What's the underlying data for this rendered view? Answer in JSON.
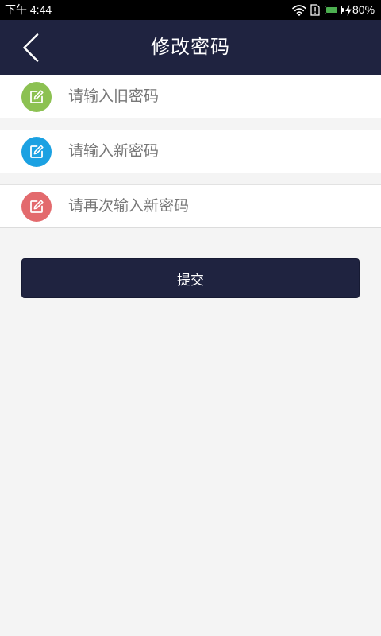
{
  "status_bar": {
    "time": "下午 4:44",
    "icons": [
      "wifi-icon",
      "sim-alert-icon",
      "battery-icon",
      "charging-icon"
    ],
    "battery_text": "80%",
    "battery_level": 0.8,
    "battery_color": "#4caf50"
  },
  "header": {
    "back_icon": "chevron-left-icon",
    "title": "修改密码",
    "background": "#1f2340"
  },
  "form": {
    "fields": [
      {
        "icon": "edit-icon",
        "icon_color": "#8cc152",
        "placeholder": "请输入旧密码",
        "value": ""
      },
      {
        "icon": "edit-icon",
        "icon_color": "#1ba1e2",
        "placeholder": "请输入新密码",
        "value": ""
      },
      {
        "icon": "edit-icon",
        "icon_color": "#e36a6d",
        "placeholder": "请再次输入新密码",
        "value": ""
      }
    ]
  },
  "submit_button": {
    "label": "提交",
    "background": "#1f2340"
  },
  "colors": {
    "page_background": "#f4f4f4",
    "placeholder": "#777777"
  }
}
